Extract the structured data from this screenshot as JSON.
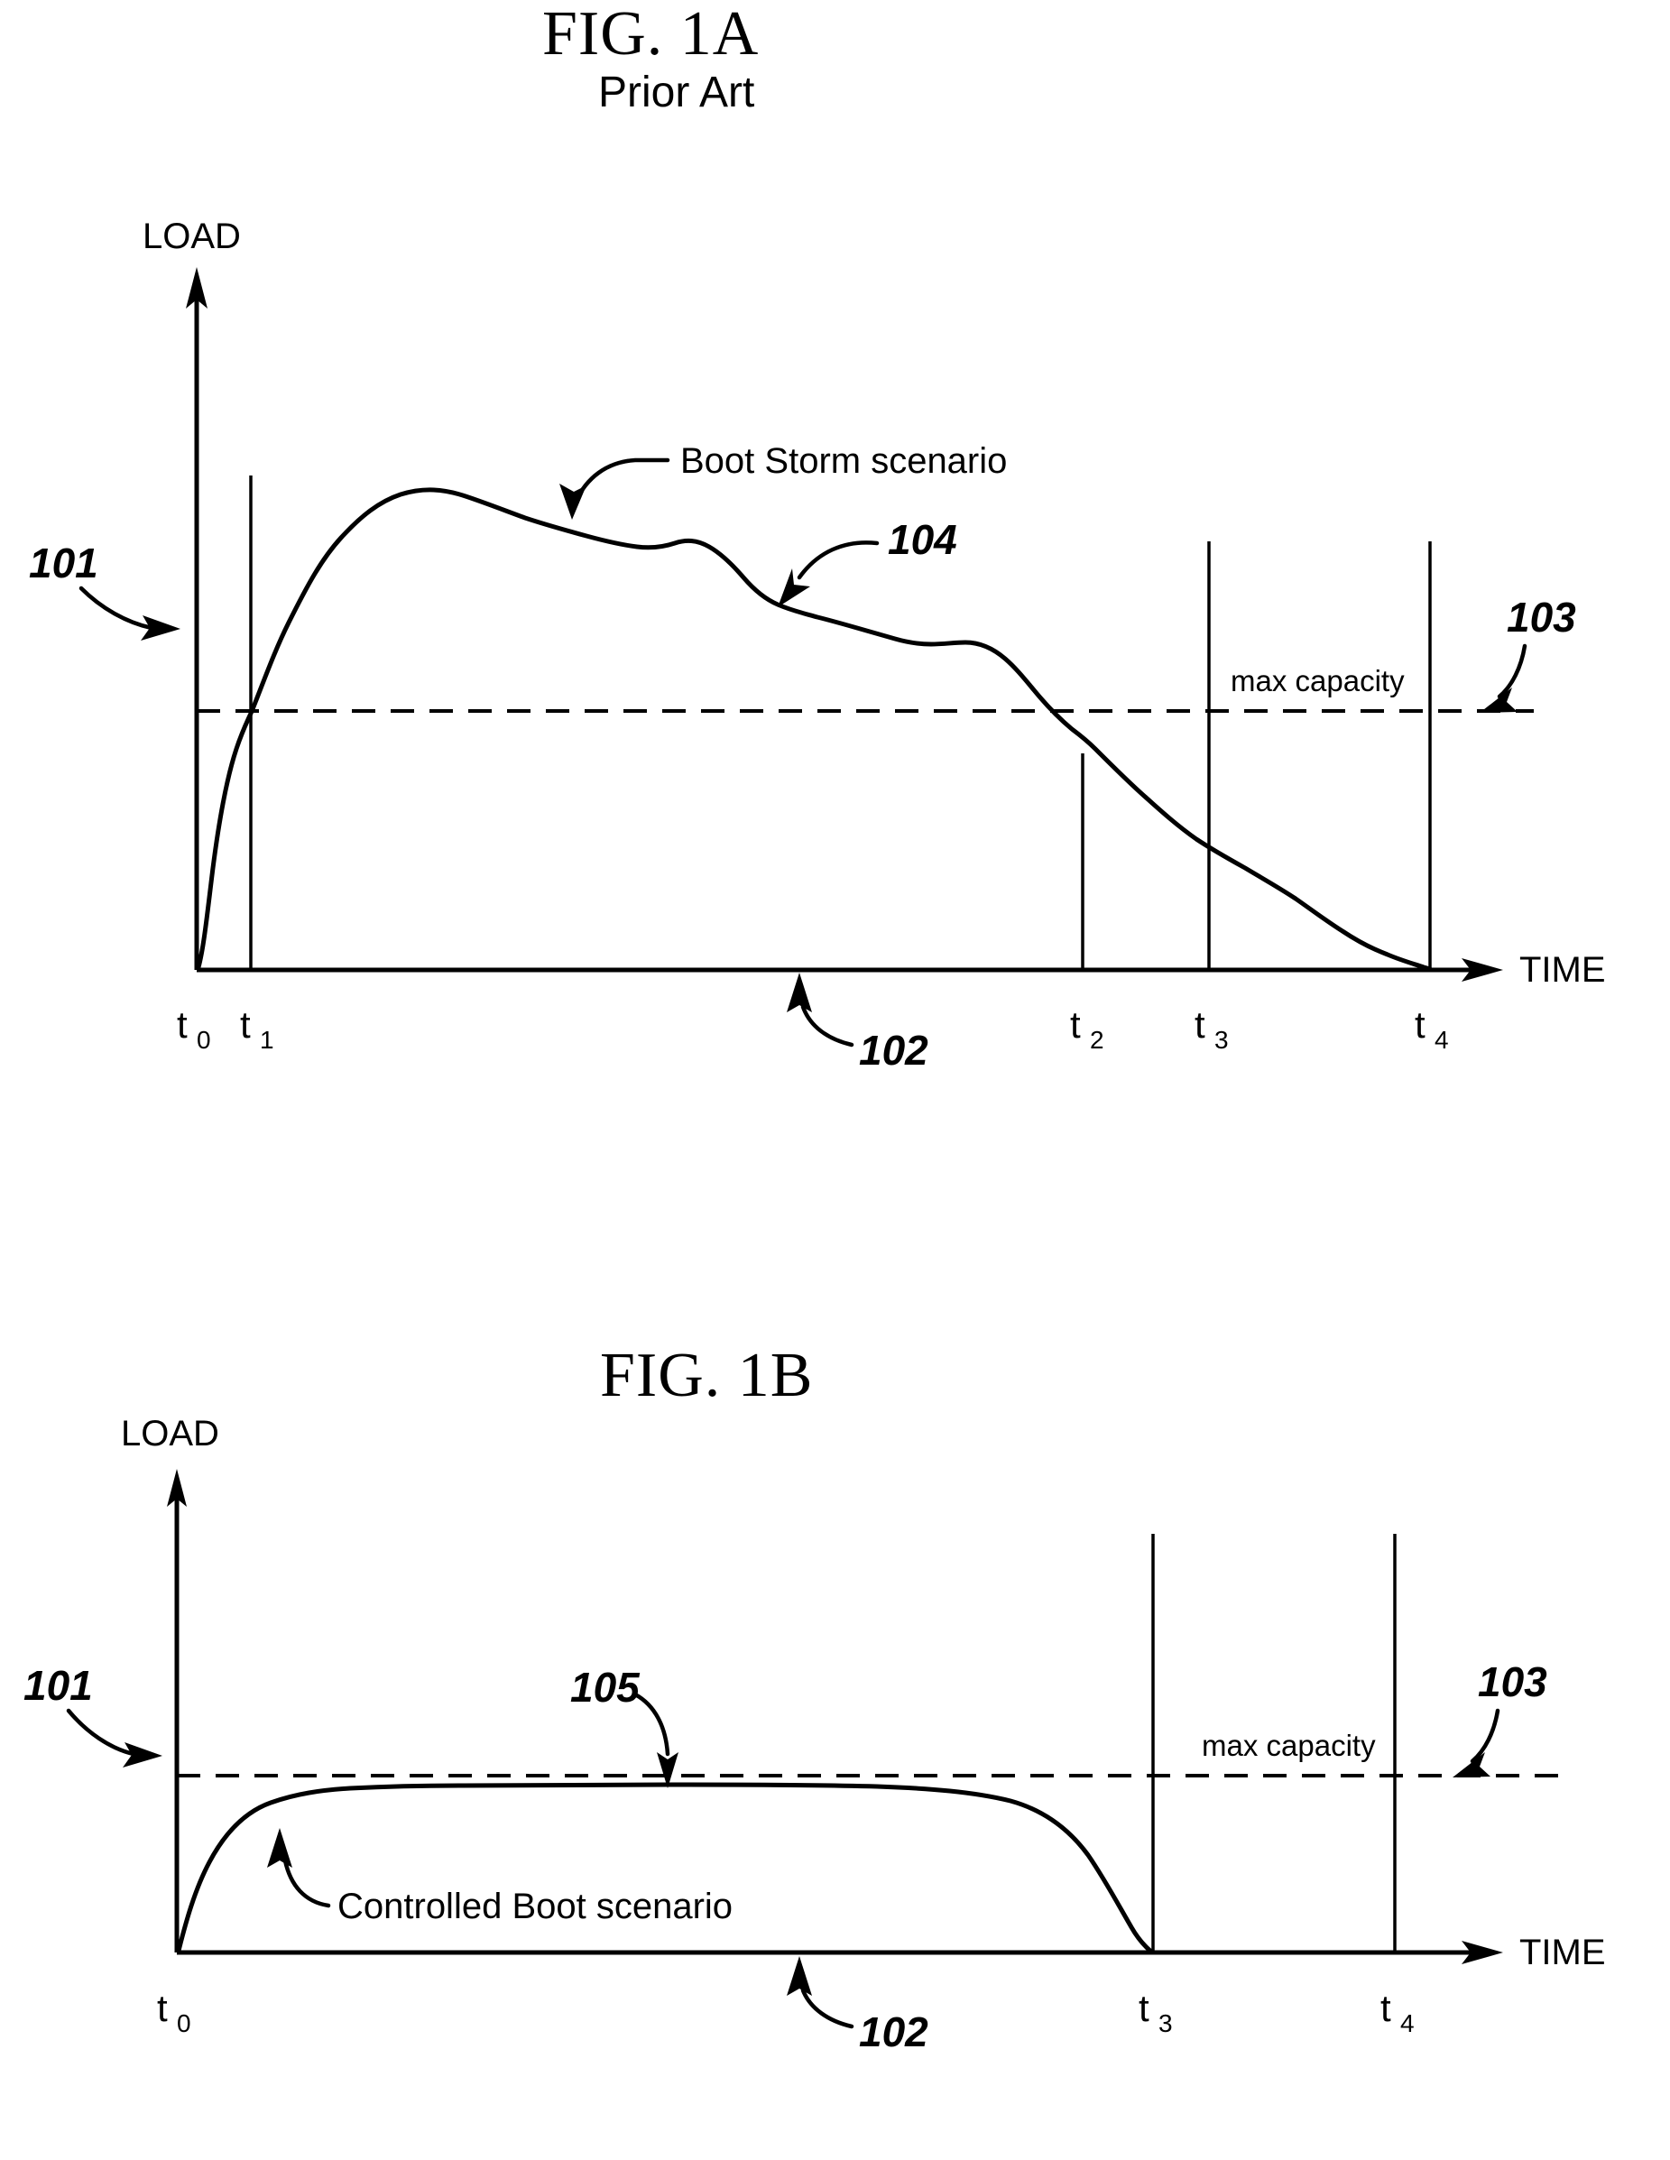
{
  "document": {
    "kind": "patent-drawing-sheet",
    "background_color": "#ffffff",
    "ink_color": "#000000"
  },
  "figures": [
    {
      "id": "fig-1a",
      "title": "FIG. 1A",
      "subtitle": "Prior Art",
      "y_axis_label": "LOAD",
      "x_axis_label": "TIME",
      "threshold_label": "max capacity",
      "curve_label": "Boot Storm scenario",
      "reference_numerals": [
        {
          "id": "101",
          "text": "101",
          "target": "y-axis (LOAD axis)"
        },
        {
          "id": "102",
          "text": "102",
          "target": "x-axis (TIME axis)"
        },
        {
          "id": "103",
          "text": "103",
          "target": "max capacity dashed line"
        },
        {
          "id": "104",
          "text": "104",
          "target": "boot storm load curve"
        }
      ],
      "tick_labels": [
        {
          "base": "t",
          "sub": "0"
        },
        {
          "base": "t",
          "sub": "1"
        },
        {
          "base": "t",
          "sub": "2"
        },
        {
          "base": "t",
          "sub": "3"
        },
        {
          "base": "t",
          "sub": "4"
        }
      ]
    },
    {
      "id": "fig-1b",
      "title": "FIG. 1B",
      "subtitle": "",
      "y_axis_label": "LOAD",
      "x_axis_label": "TIME",
      "threshold_label": "max capacity",
      "curve_label": "Controlled Boot scenario",
      "reference_numerals": [
        {
          "id": "101",
          "text": "101",
          "target": "y-axis (LOAD axis)"
        },
        {
          "id": "102",
          "text": "102",
          "target": "x-axis (TIME axis)"
        },
        {
          "id": "103",
          "text": "103",
          "target": "max capacity dashed line"
        },
        {
          "id": "105",
          "text": "105",
          "target": "controlled boot load curve"
        }
      ],
      "tick_labels": [
        {
          "base": "t",
          "sub": "0"
        },
        {
          "base": "t",
          "sub": "3"
        },
        {
          "base": "t",
          "sub": "4"
        }
      ]
    }
  ],
  "chart_data": [
    {
      "type": "line",
      "title": "FIG. 1A",
      "subtitle": "Prior Art",
      "xlabel": "TIME",
      "ylabel": "LOAD",
      "grid": false,
      "legend": "none",
      "xlim": [
        0,
        10
      ],
      "ylim": [
        0,
        10
      ],
      "xtick_labels": [
        "t0",
        "t1",
        "t2",
        "t3",
        "t4"
      ],
      "xtick_positions": [
        0.0,
        0.43,
        7.0,
        8.0,
        9.8
      ],
      "annotations": [
        {
          "text": "max capacity",
          "x": 8.15,
          "y": 4.2
        },
        {
          "text": "Boot Storm scenario",
          "x": 4.3,
          "y": 7.3
        },
        {
          "text": "101",
          "x": -1.1,
          "y": 5.5
        },
        {
          "text": "102",
          "x": 5.3,
          "y": -1.0
        },
        {
          "text": "103",
          "x": 9.9,
          "y": 5.3
        },
        {
          "text": "104",
          "x": 5.9,
          "y": 6.1
        }
      ],
      "threshold_line": {
        "label": "max capacity",
        "y": 4.0,
        "style": "dashed"
      },
      "series": [
        {
          "name": "Boot Storm scenario",
          "x": [
            0.0,
            0.12,
            0.25,
            0.43,
            0.8,
            1.2,
            1.6,
            2.1,
            2.6,
            3.2,
            3.9,
            4.6,
            5.1,
            5.5,
            5.9,
            6.3,
            6.7,
            7.0,
            7.6,
            8.0,
            8.6,
            9.1,
            9.5,
            9.8
          ],
          "y": [
            0.05,
            0.9,
            2.2,
            4.0,
            6.3,
            7.7,
            8.2,
            8.2,
            7.9,
            7.5,
            7.0,
            6.3,
            5.7,
            5.3,
            5.1,
            4.9,
            4.5,
            4.0,
            3.3,
            2.9,
            2.4,
            1.9,
            1.2,
            0.0
          ]
        }
      ]
    },
    {
      "type": "line",
      "title": "FIG. 1B",
      "subtitle": "",
      "xlabel": "TIME",
      "ylabel": "LOAD",
      "grid": false,
      "legend": "none",
      "xlim": [
        0,
        10
      ],
      "ylim": [
        0,
        10
      ],
      "xtick_labels": [
        "t0",
        "t3",
        "t4"
      ],
      "xtick_positions": [
        0.0,
        7.8,
        9.5
      ],
      "annotations": [
        {
          "text": "max capacity",
          "x": 8.1,
          "y": 4.6
        },
        {
          "text": "Controlled Boot scenario",
          "x": 2.2,
          "y": 1.5
        },
        {
          "text": "101",
          "x": -1.1,
          "y": 6.0
        },
        {
          "text": "102",
          "x": 5.4,
          "y": -1.0
        },
        {
          "text": "103",
          "x": 9.9,
          "y": 5.6
        },
        {
          "text": "105",
          "x": 5.0,
          "y": 5.4
        }
      ],
      "threshold_line": {
        "label": "max capacity",
        "y": 4.0,
        "style": "dashed"
      },
      "series": [
        {
          "name": "Controlled Boot scenario",
          "x": [
            0.0,
            0.2,
            0.5,
            0.9,
            1.4,
            2.0,
            3.0,
            4.0,
            5.0,
            6.0,
            6.6,
            7.0,
            7.3,
            7.55,
            7.7,
            7.8
          ],
          "y": [
            0.0,
            1.6,
            2.8,
            3.4,
            3.65,
            3.75,
            3.8,
            3.8,
            3.8,
            3.75,
            3.65,
            3.4,
            2.7,
            1.6,
            0.7,
            0.0
          ]
        }
      ]
    }
  ]
}
